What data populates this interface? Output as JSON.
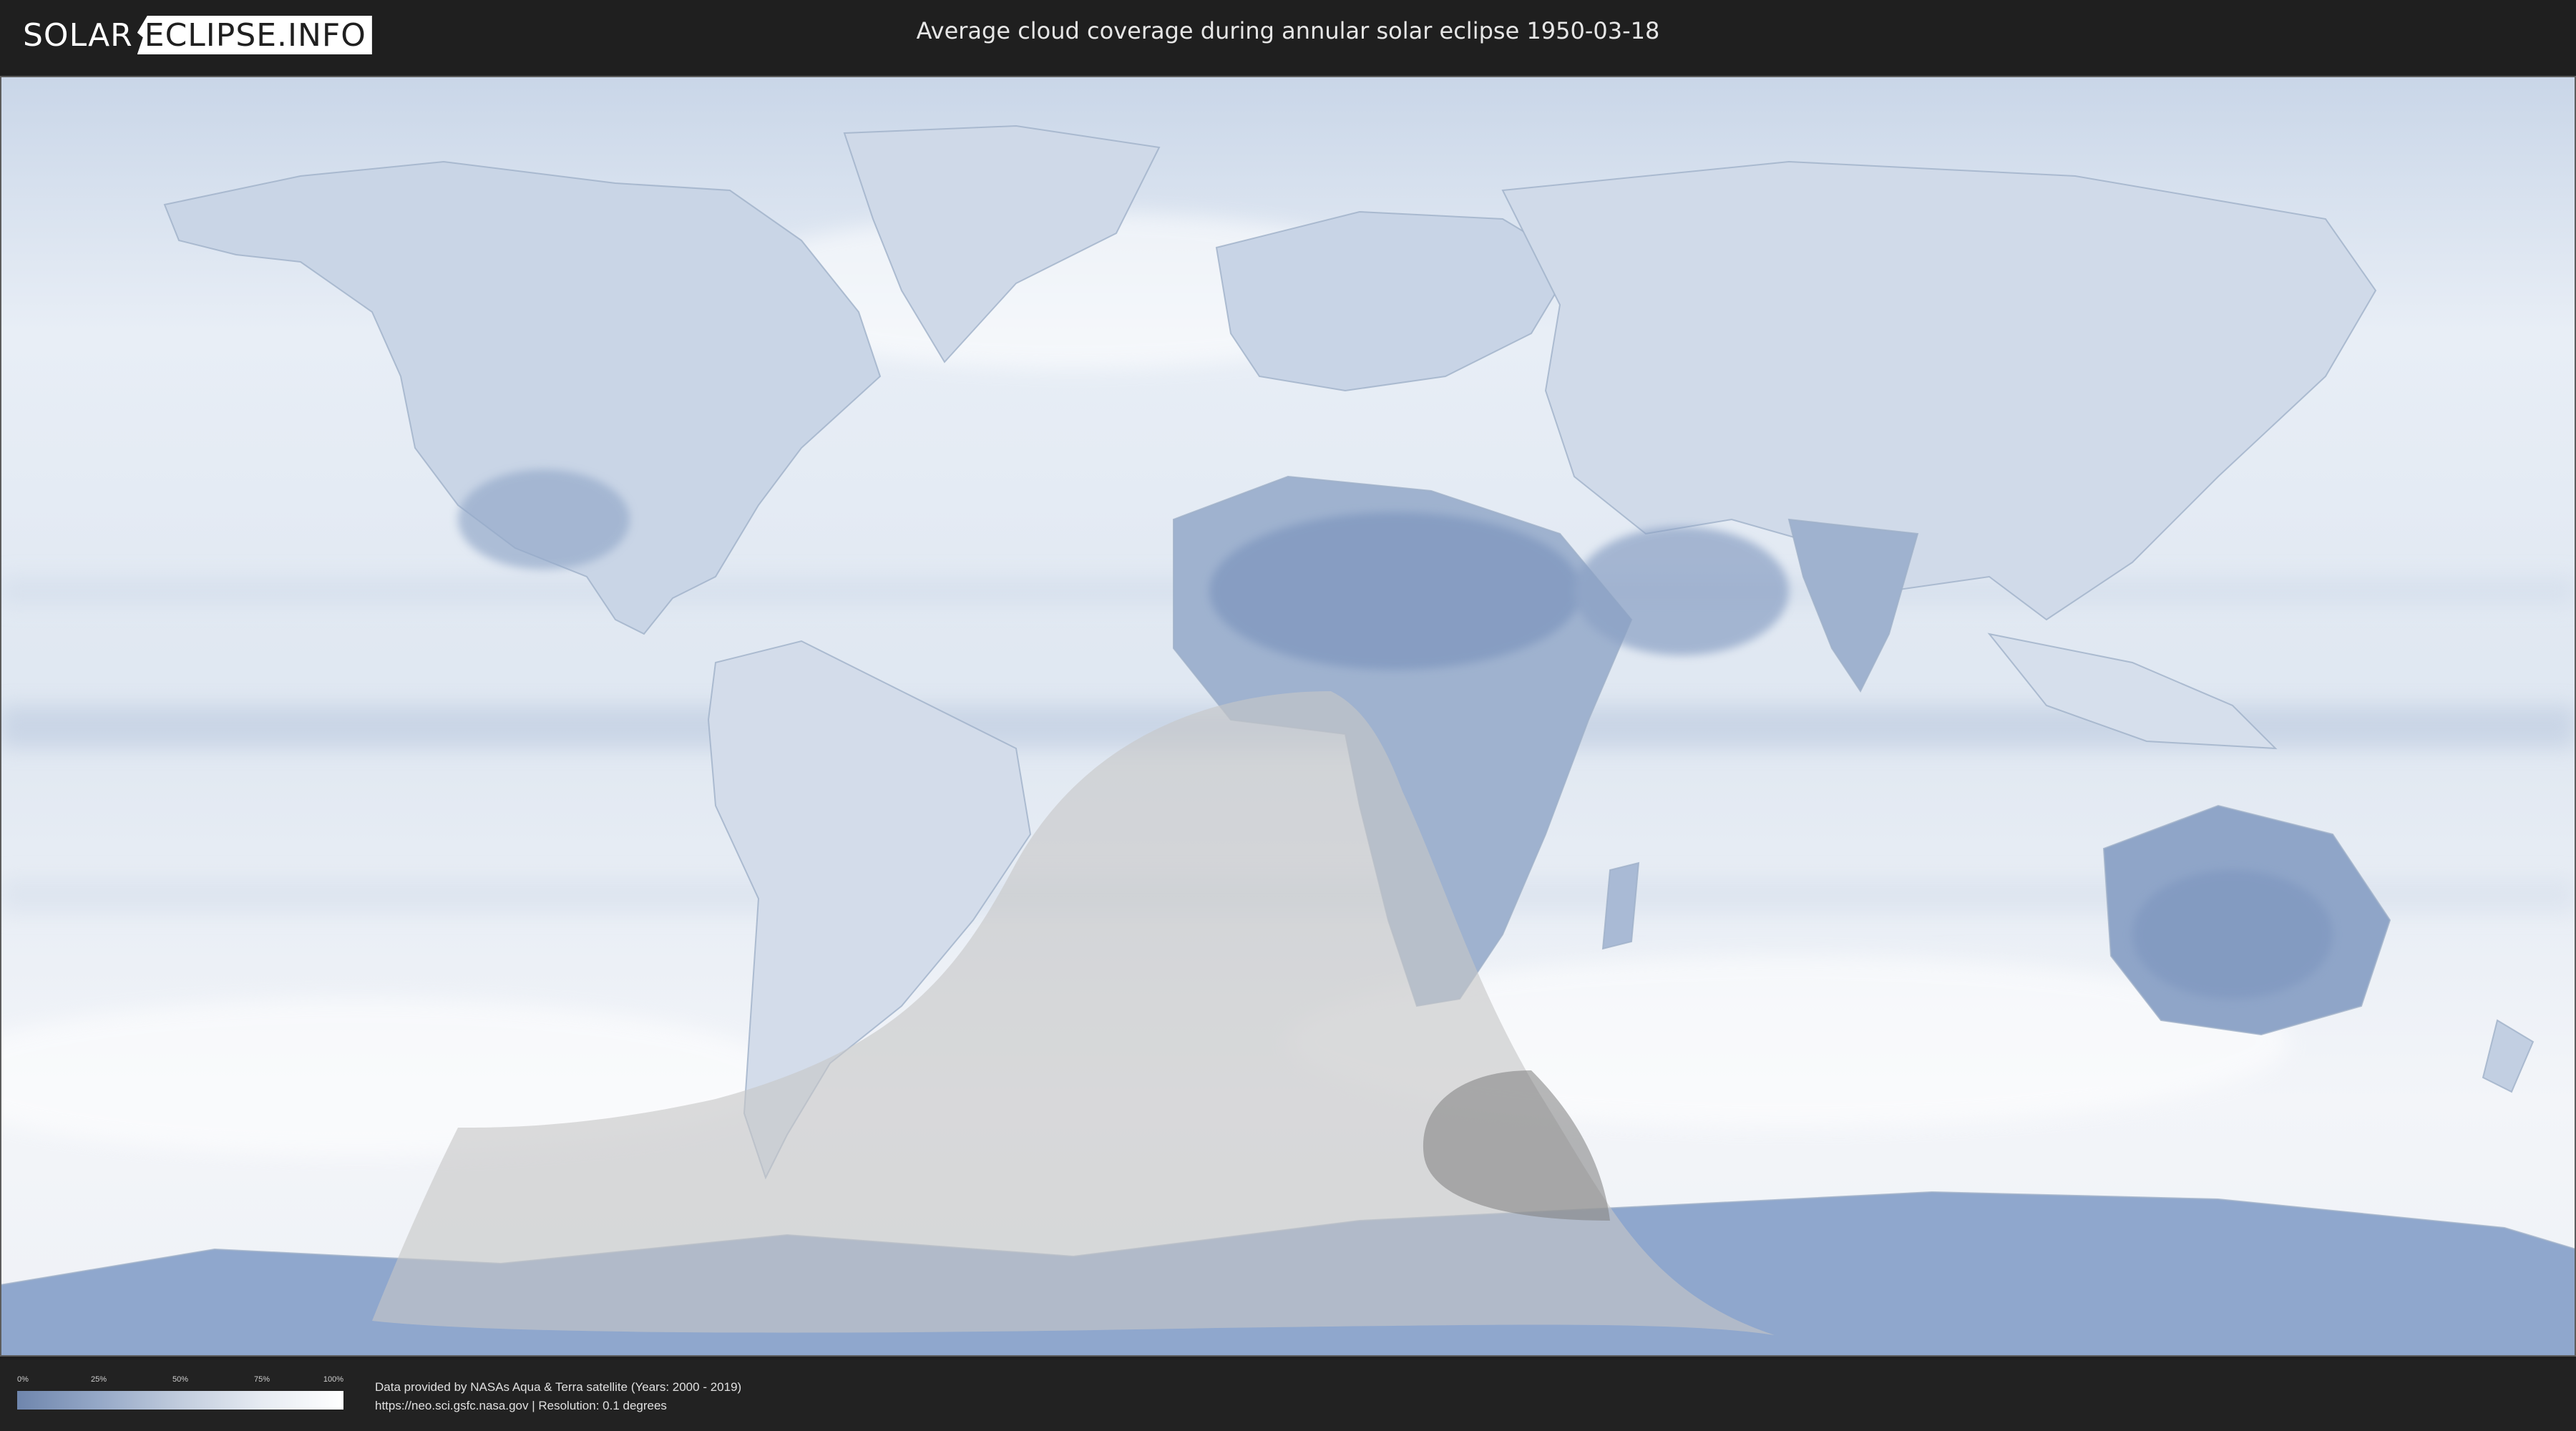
{
  "header": {
    "logo_part1": "SOLAR",
    "logo_part2": "ECLIPSE.INFO",
    "title": "Average cloud coverage during annular solar eclipse 1950-03-18"
  },
  "legend": {
    "ticks": [
      "0%",
      "25%",
      "50%",
      "75%",
      "100%"
    ],
    "color_low": "#6f86ad",
    "color_high": "#ffffff"
  },
  "footer": {
    "credit_line1": "Data provided by NASAs Aqua & Terra satellite (Years: 2000 - 2019)",
    "credit_line2": "https://neo.sci.gsfc.nasa.gov | Resolution: 0.1 degrees"
  },
  "colors": {
    "background": "#1e1e1e",
    "ocean_cloud": "#eef2f8",
    "land_clear": "#7f98bf",
    "eclipse_zone": "#c8c8c8",
    "umbra_path": "#8c8c8c"
  }
}
